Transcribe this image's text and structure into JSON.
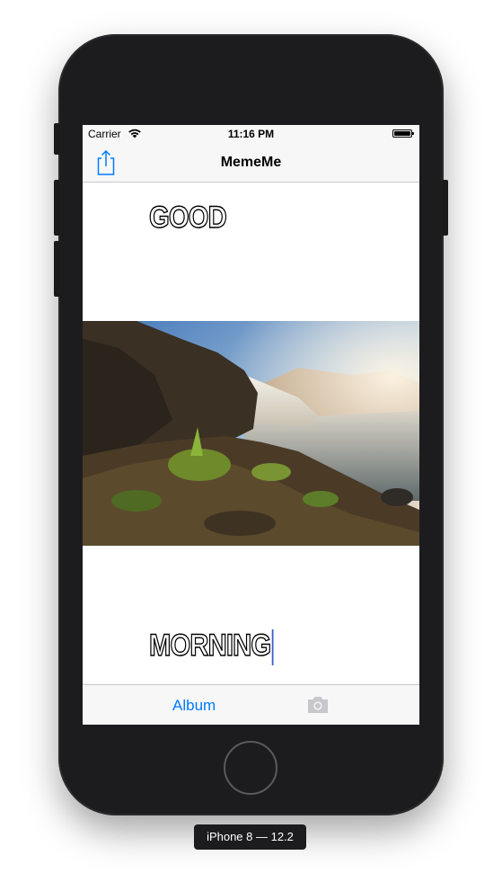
{
  "status_bar": {
    "carrier": "Carrier",
    "time": "11:16 PM"
  },
  "nav": {
    "title": "MemeMe",
    "share_icon": "share-icon"
  },
  "meme": {
    "top_text": "GOOD",
    "bottom_text": "MORNING",
    "image": "waterfall landscape photo"
  },
  "toolbar": {
    "album_label": "Album",
    "camera_icon": "camera-icon",
    "camera_enabled": false
  },
  "device": {
    "label": "iPhone 8 — 12.2"
  },
  "colors": {
    "accent": "#007aff",
    "bar_bg": "#f7f7f7",
    "device_body": "#1c1c1e"
  }
}
